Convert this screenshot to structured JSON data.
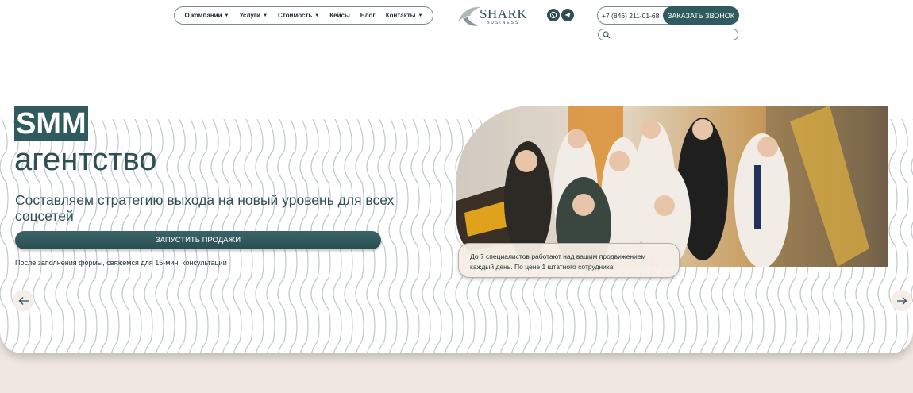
{
  "header": {
    "nav": [
      {
        "label": "О компании",
        "dropdown": true
      },
      {
        "label": "Услуги",
        "dropdown": true
      },
      {
        "label": "Стоимость",
        "dropdown": true
      },
      {
        "label": "Кейсы",
        "dropdown": false
      },
      {
        "label": "Блог",
        "dropdown": false
      },
      {
        "label": "Контакты",
        "dropdown": true
      }
    ],
    "logo": {
      "name": "SHARK",
      "sub": "BUSINESS"
    },
    "phone": "+7 (846) 211-01-68",
    "call_button": "ЗАКАЗАТЬ ЗВОНОК",
    "search_placeholder": ""
  },
  "hero": {
    "title_highlight": "SMM",
    "title_rest": "агентство",
    "subtitle": "Составляем стратегию выхода на новый уровень для всех соцсетей",
    "cta": "ЗАПУСТИТЬ ПРОДАЖИ",
    "note": "После заполнения формы, свяжемся для 15-мин. консультации",
    "caption_line1": "До 7 специалистов работают над вашим продвижением",
    "caption_line2": "каждый день. По цене 1 штатного сотрудника"
  },
  "colors": {
    "accent": "#2f5a5e",
    "text": "#2f4f52",
    "bottom_band": "#efe8e0"
  },
  "icons": [
    "whatsapp-icon",
    "telegram-icon",
    "search-icon",
    "arrow-left-icon",
    "arrow-right-icon"
  ]
}
